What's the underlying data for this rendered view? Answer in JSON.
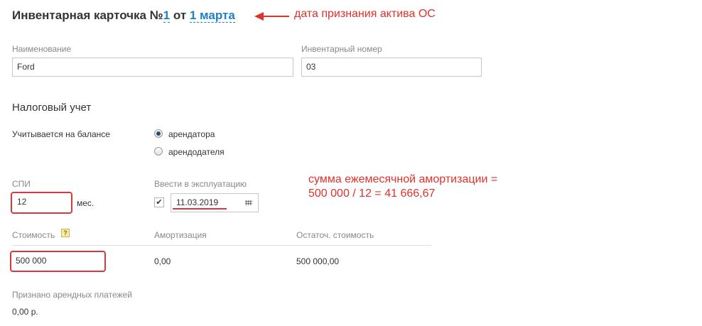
{
  "header": {
    "title_prefix": "Инвентарная карточка №",
    "number": "1",
    "from_word": " от ",
    "date": "1 марта"
  },
  "annotations": {
    "date_note": "дата признания актива ОС",
    "amort_line1": "сумма ежемесячной амортизации =",
    "amort_line2": "500 000 / 12 = 41 666,67",
    "color": "#e0312b"
  },
  "fields": {
    "name_label": "Наименование",
    "name_value": "Ford",
    "inventory_label": "Инвентарный номер",
    "inventory_value": "03"
  },
  "tax": {
    "section_title": "Налоговый учет",
    "balance_label": "Учитывается на балансе",
    "options": [
      {
        "label": "арендатора",
        "selected": true
      },
      {
        "label": "арендодателя",
        "selected": false
      }
    ]
  },
  "spi": {
    "label": "СПИ",
    "value": "12",
    "unit": "мес."
  },
  "commissioning": {
    "label": "Ввести в эксплуатацию",
    "checked": true,
    "check_glyph": "✔",
    "date": "11.03.2019"
  },
  "values": {
    "cost_label": "Стоимость",
    "hint_glyph": "?",
    "cost_value": "500 000",
    "amort_label": "Амортизация",
    "amort_value": "0,00",
    "residual_label": "Остаточ. стоимость",
    "residual_value": "500 000,00"
  },
  "lease": {
    "label": "Признано арендных платежей",
    "value": "0,00 р."
  }
}
